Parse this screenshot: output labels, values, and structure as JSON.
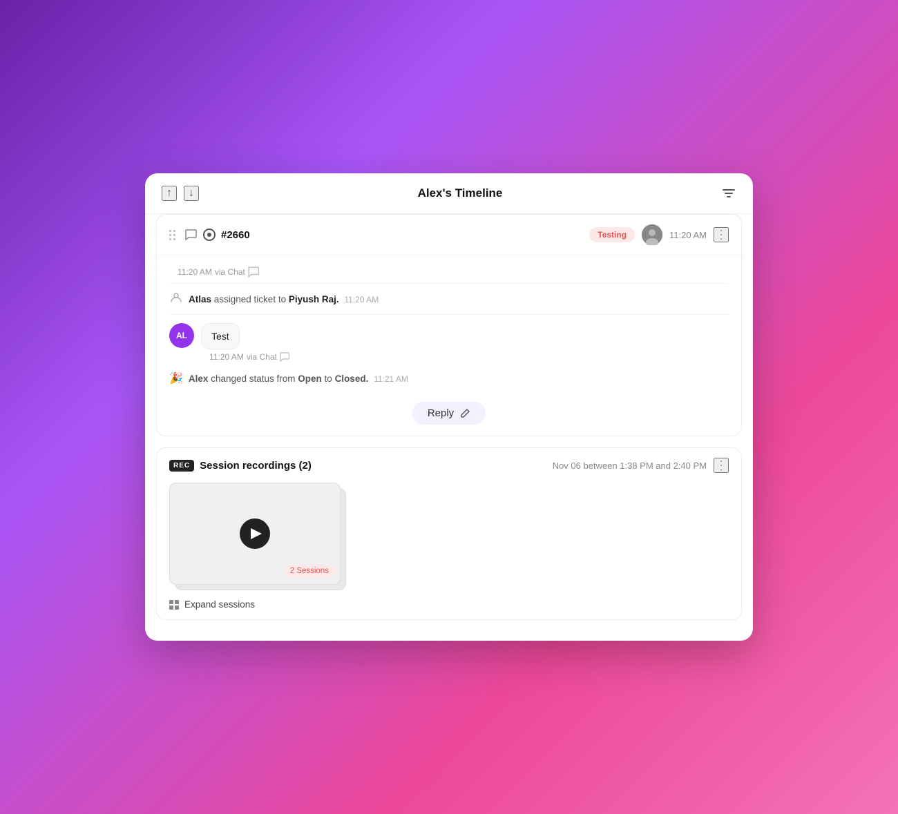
{
  "header": {
    "title": "Alex's Timeline",
    "nav_up": "↑",
    "nav_down": "↓"
  },
  "ticket": {
    "id": "#2660",
    "status_badge": "Testing",
    "timestamp": "11:20 AM",
    "messages": [
      {
        "time": "11:20 AM",
        "via": "via Chat"
      }
    ],
    "activity": [
      {
        "type": "assign",
        "text_prefix": "Atlas",
        "text_middle": "assigned ticket to",
        "text_bold": "Piyush Raj.",
        "time": "11:20 AM"
      }
    ],
    "chat_messages": [
      {
        "avatar": "AL",
        "bubble_text": "Test",
        "time": "11:20 AM",
        "via": "via Chat"
      }
    ],
    "status_change": {
      "agent": "Alex",
      "verb": "changed status from",
      "from_status": "Open",
      "to_text": "to",
      "to_status": "Closed.",
      "time": "11:21 AM"
    },
    "reply_label": "Reply"
  },
  "session_recordings": {
    "title": "Session recordings (2)",
    "date_range": "Nov 06 between 1:38 PM and 2:40 PM",
    "sessions_badge": "2 Sessions",
    "expand_label": "Expand sessions",
    "icon_label": "REC"
  }
}
